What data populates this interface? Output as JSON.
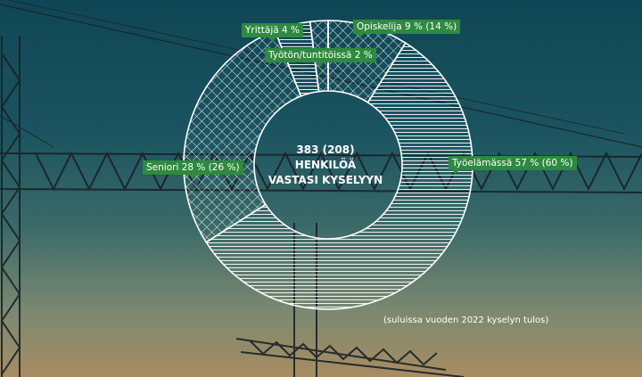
{
  "chart_data": {
    "type": "pie",
    "donut": true,
    "title": "",
    "center_lines": [
      "383 (208)",
      "HENKILÖÄ",
      "VASTASI KYSELYYN"
    ],
    "note": "(suluissa vuoden 2022 kyselyn tulos)",
    "slices": [
      {
        "key": "opiskelija",
        "label": "Opiskelija 9 % (14 %)",
        "value": 9,
        "prev": 14,
        "pattern": "crosshatch"
      },
      {
        "key": "tyoelamassa",
        "label": "Työelämässä 57 % (60 %)",
        "value": 57,
        "prev": 60,
        "pattern": "stripes"
      },
      {
        "key": "seniori",
        "label": "Seniori 28 % (26 %)",
        "value": 28,
        "prev": 26,
        "pattern": "crosshatch"
      },
      {
        "key": "yrittaja",
        "label": "Yrittäjä 4 %",
        "value": 4,
        "prev": null,
        "pattern": "stripes"
      },
      {
        "key": "tyoton",
        "label": "Työtön/tuntitöissä 2 %",
        "value": 2,
        "prev": null,
        "pattern": "crosshatch"
      }
    ],
    "colors": {
      "label_bg": "#2e8a3e",
      "ring": "#ffffff"
    }
  }
}
